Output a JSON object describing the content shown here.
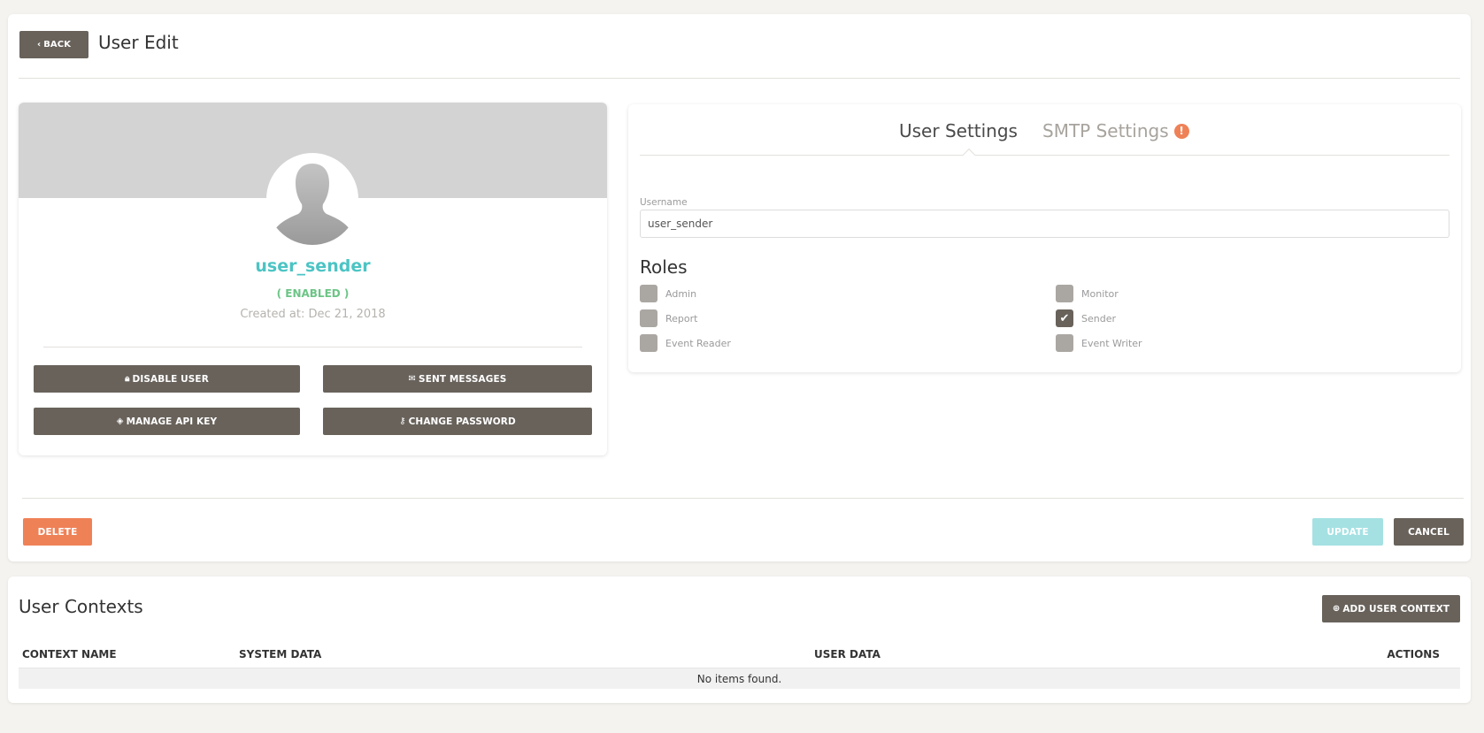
{
  "header": {
    "back_label": "BACK",
    "title": "User Edit"
  },
  "profile": {
    "name": "user_sender",
    "status": "( ENABLED )",
    "created": "Created at: Dec 21, 2018",
    "actions": {
      "disable": "DISABLE USER",
      "sent_messages": "SENT MESSAGES",
      "manage_api_key": "MANAGE API KEY",
      "change_password": "CHANGE PASSWORD"
    }
  },
  "settings": {
    "tabs": {
      "user": "User Settings",
      "smtp": "SMTP Settings",
      "smtp_warning": "!"
    },
    "username_label": "Username",
    "username_value": "user_sender",
    "roles_title": "Roles",
    "roles": [
      {
        "label": "Admin",
        "checked": false
      },
      {
        "label": "Monitor",
        "checked": false
      },
      {
        "label": "Report",
        "checked": false
      },
      {
        "label": "Sender",
        "checked": true
      },
      {
        "label": "Event Reader",
        "checked": false
      },
      {
        "label": "Event Writer",
        "checked": false
      }
    ]
  },
  "footer": {
    "delete_label": "DELETE",
    "update_label": "UPDATE",
    "cancel_label": "CANCEL"
  },
  "contexts": {
    "title": "User Contexts",
    "add_label": "ADD USER CONTEXT",
    "columns": [
      "CONTEXT NAME",
      "SYSTEM DATA",
      "USER DATA",
      "ACTIONS"
    ],
    "empty_text": "No items found."
  },
  "colors": {
    "primary_button": "#68625b",
    "danger": "#ef8157",
    "info_disabled": "#a5e1e3",
    "name_accent": "#4cc4c4",
    "success": "#6cc586",
    "page_bg": "#f4f3ef"
  }
}
